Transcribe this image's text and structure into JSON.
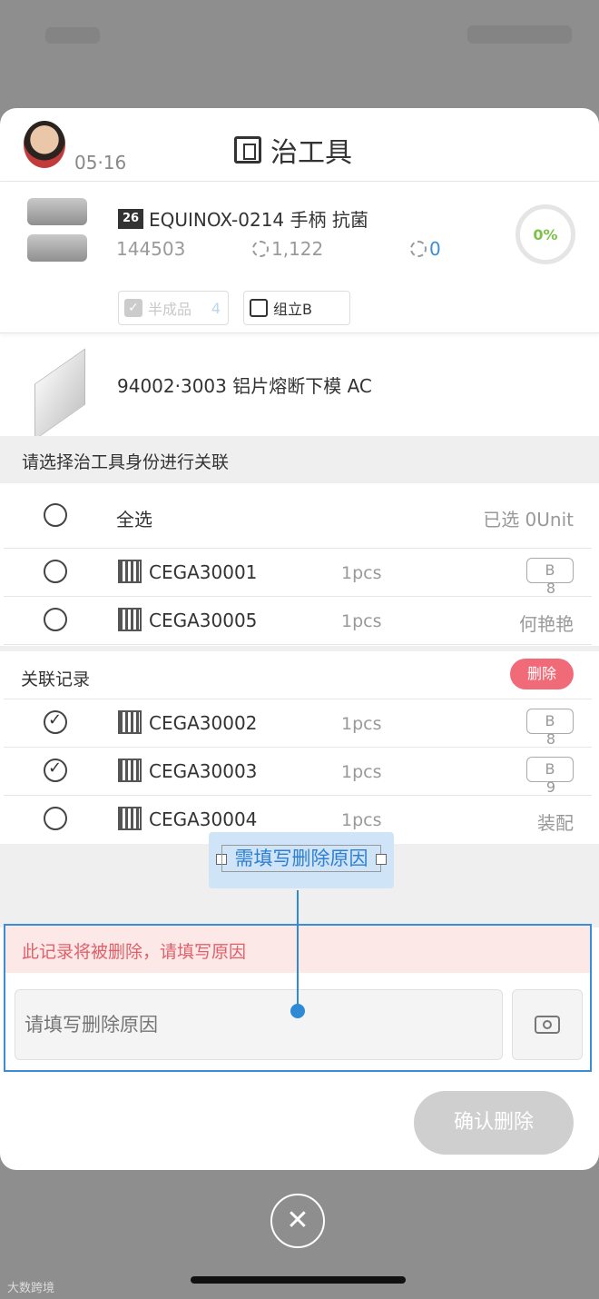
{
  "header": {
    "date": "05·16",
    "title": "治工具"
  },
  "product": {
    "badge": "26",
    "name": "EQUINOX-0214 手柄 抗菌",
    "code": "144503",
    "stat1": "1,122",
    "stat2": "0",
    "progress": "0%",
    "progress_value": 0,
    "tags": [
      {
        "label": "半成品",
        "count": "4",
        "checked": true
      },
      {
        "label": "组立B",
        "checked": false
      }
    ]
  },
  "mold": {
    "name": "94002·3003 铝片熔断下模 AC"
  },
  "select_section": {
    "heading": "请选择治工具身份进行关联",
    "select_all": "全选",
    "selected_info": "已选 0Unit",
    "rows": [
      {
        "code": "CEGA30001",
        "qty": "1pcs",
        "chip": "B",
        "chip_sub": "8"
      },
      {
        "code": "CEGA30005",
        "qty": "1pcs",
        "right": "何艳艳"
      }
    ]
  },
  "records": {
    "heading": "关联记录",
    "delete_label": "删除",
    "rows": [
      {
        "code": "CEGA30002",
        "qty": "1pcs",
        "chip": "B",
        "chip_sub": "8",
        "checked": true
      },
      {
        "code": "CEGA30003",
        "qty": "1pcs",
        "chip": "B",
        "chip_sub": "9",
        "checked": true
      },
      {
        "code": "CEGA30004",
        "qty": "1pcs",
        "right": "装配",
        "checked": false
      }
    ]
  },
  "annotation": {
    "tooltip": "需填写删除原因"
  },
  "delete_reason": {
    "warning": "此记录将被删除，请填写原因",
    "placeholder": "请填写删除原因"
  },
  "confirm_label": "确认删除",
  "close_symbol": "✕",
  "watermark": "大数跨境",
  "colors": {
    "accent_blue": "#3a8ed8",
    "delete_red": "#f06a78",
    "warn_text": "#e0606a",
    "progress_green": "#7cc24a"
  }
}
